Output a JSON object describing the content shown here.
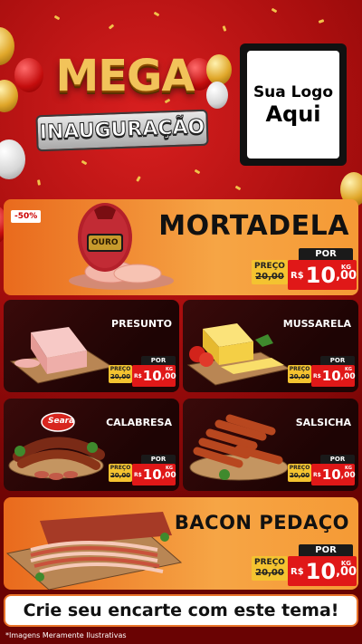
{
  "header": {
    "mega": "MEGA",
    "inauguracao": "INAUGURAÇÃO",
    "logo_line1": "Sua Logo",
    "logo_line2": "Aqui"
  },
  "featured": [
    {
      "name": "MORTADELA",
      "badge": "-50%",
      "brand_label": "OURO",
      "price_label": "POR",
      "old_label": "PREÇO",
      "old_price": "20,00",
      "currency": "R$",
      "price_int": "10",
      "price_dec": ",00",
      "unit": "KG"
    },
    {
      "name": "BACON PEDAÇO",
      "price_label": "POR",
      "old_label": "PREÇO",
      "old_price": "20,00",
      "currency": "R$",
      "price_int": "10",
      "price_dec": ",00",
      "unit": "KG"
    }
  ],
  "products": [
    {
      "name": "PRESUNTO",
      "price_label": "POR",
      "old_label": "PREÇO",
      "old_price": "20,00",
      "currency": "R$",
      "price_int": "10",
      "price_dec": ",00",
      "unit": "KG"
    },
    {
      "name": "MUSSARELA",
      "price_label": "POR",
      "old_label": "PREÇO",
      "old_price": "20,00",
      "currency": "R$",
      "price_int": "10",
      "price_dec": ",00",
      "unit": "KG"
    },
    {
      "name": "CALABRESA",
      "brand_label": "Seara",
      "price_label": "POR",
      "old_label": "PREÇO",
      "old_price": "20,00",
      "currency": "R$",
      "price_int": "10",
      "price_dec": ",00",
      "unit": "KG"
    },
    {
      "name": "SALSICHA",
      "price_label": "POR",
      "old_label": "PREÇO",
      "old_price": "20,00",
      "currency": "R$",
      "price_int": "10",
      "price_dec": ",00",
      "unit": "KG"
    }
  ],
  "footer": {
    "cta": "Crie seu encarte com este tema!",
    "disclaimer": "*Imagens Meramente Ilustrativas"
  },
  "colors": {
    "background": "#a80e0e",
    "card_orange": "#f39a35",
    "card_dark": "#2a0707",
    "price_red": "#e01818",
    "price_yellow": "#f4c330"
  }
}
